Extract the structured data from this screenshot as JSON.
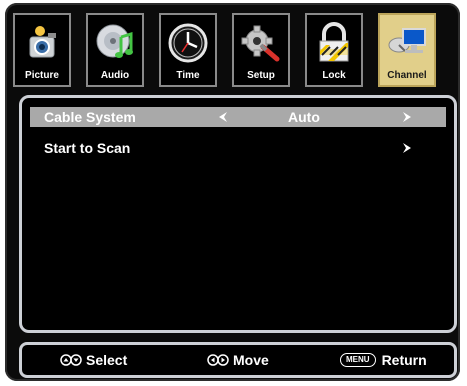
{
  "tabs": [
    {
      "label": "Picture",
      "icon": "camera-icon",
      "active": false
    },
    {
      "label": "Audio",
      "icon": "music-icon",
      "active": false
    },
    {
      "label": "Time",
      "icon": "clock-icon",
      "active": false
    },
    {
      "label": "Setup",
      "icon": "gear-icon",
      "active": false
    },
    {
      "label": "Lock",
      "icon": "lock-icon",
      "active": false
    },
    {
      "label": "Channel",
      "icon": "satellite-icon",
      "active": true
    }
  ],
  "menu": {
    "items": [
      {
        "label": "Cable System",
        "value": "Auto",
        "selected": true
      },
      {
        "label": "Start to Scan",
        "value": "",
        "selected": false
      }
    ]
  },
  "footer": {
    "select_label": "Select",
    "move_label": "Move",
    "menu_key": "MENU",
    "return_label": "Return"
  },
  "colors": {
    "highlight": "#a9a9a9",
    "active_tab": "#e1cf8a",
    "panel_border": "#cdd0d6"
  }
}
